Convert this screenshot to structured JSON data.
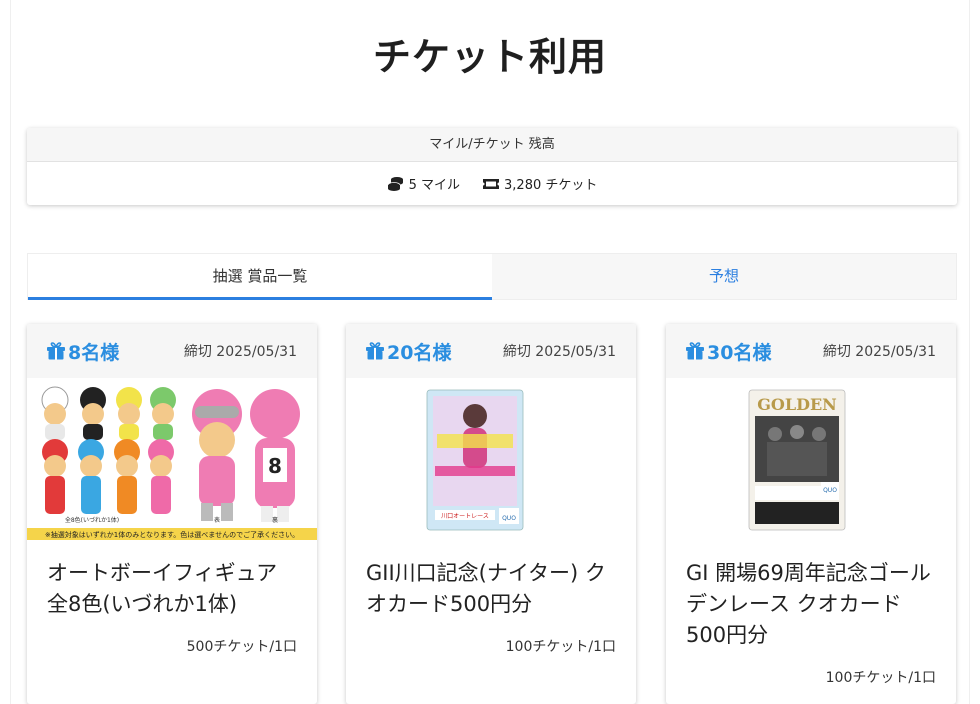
{
  "page": {
    "title": "チケット利用"
  },
  "balance": {
    "header": "マイル/チケット 残高",
    "miles": "5 マイル",
    "tickets": "3,280 チケット"
  },
  "tabs": [
    {
      "label": "抽選 賞品一覧",
      "active": true
    },
    {
      "label": "予想",
      "active": false
    }
  ],
  "prizes": [
    {
      "winners": "8名様",
      "deadline": "締切 2025/05/31",
      "title": "オートボーイフィギュア全8色(いづれか1体)",
      "price": "500チケット/1口",
      "image_note": "※抽選対象はいずれか1体のみとなります。色は選べませんのでご了承ください。",
      "image_number": "8",
      "image_labels": [
        "全8色(いづれか1体)",
        "表",
        "裏"
      ]
    },
    {
      "winners": "20名様",
      "deadline": "締切 2025/05/31",
      "title": "GII川口記念(ナイター) クオカード500円分",
      "price": "100チケット/1口",
      "image_text": "川口オートレース"
    },
    {
      "winners": "30名様",
      "deadline": "締切 2025/05/31",
      "title": "GI 開場69周年記念ゴールデンレース クオカード500円分",
      "price": "100チケット/1口",
      "image_text": "GOLDEN"
    }
  ],
  "colors": {
    "accent": "#2b8ee0",
    "tab_indicator": "#2b7fe0"
  }
}
